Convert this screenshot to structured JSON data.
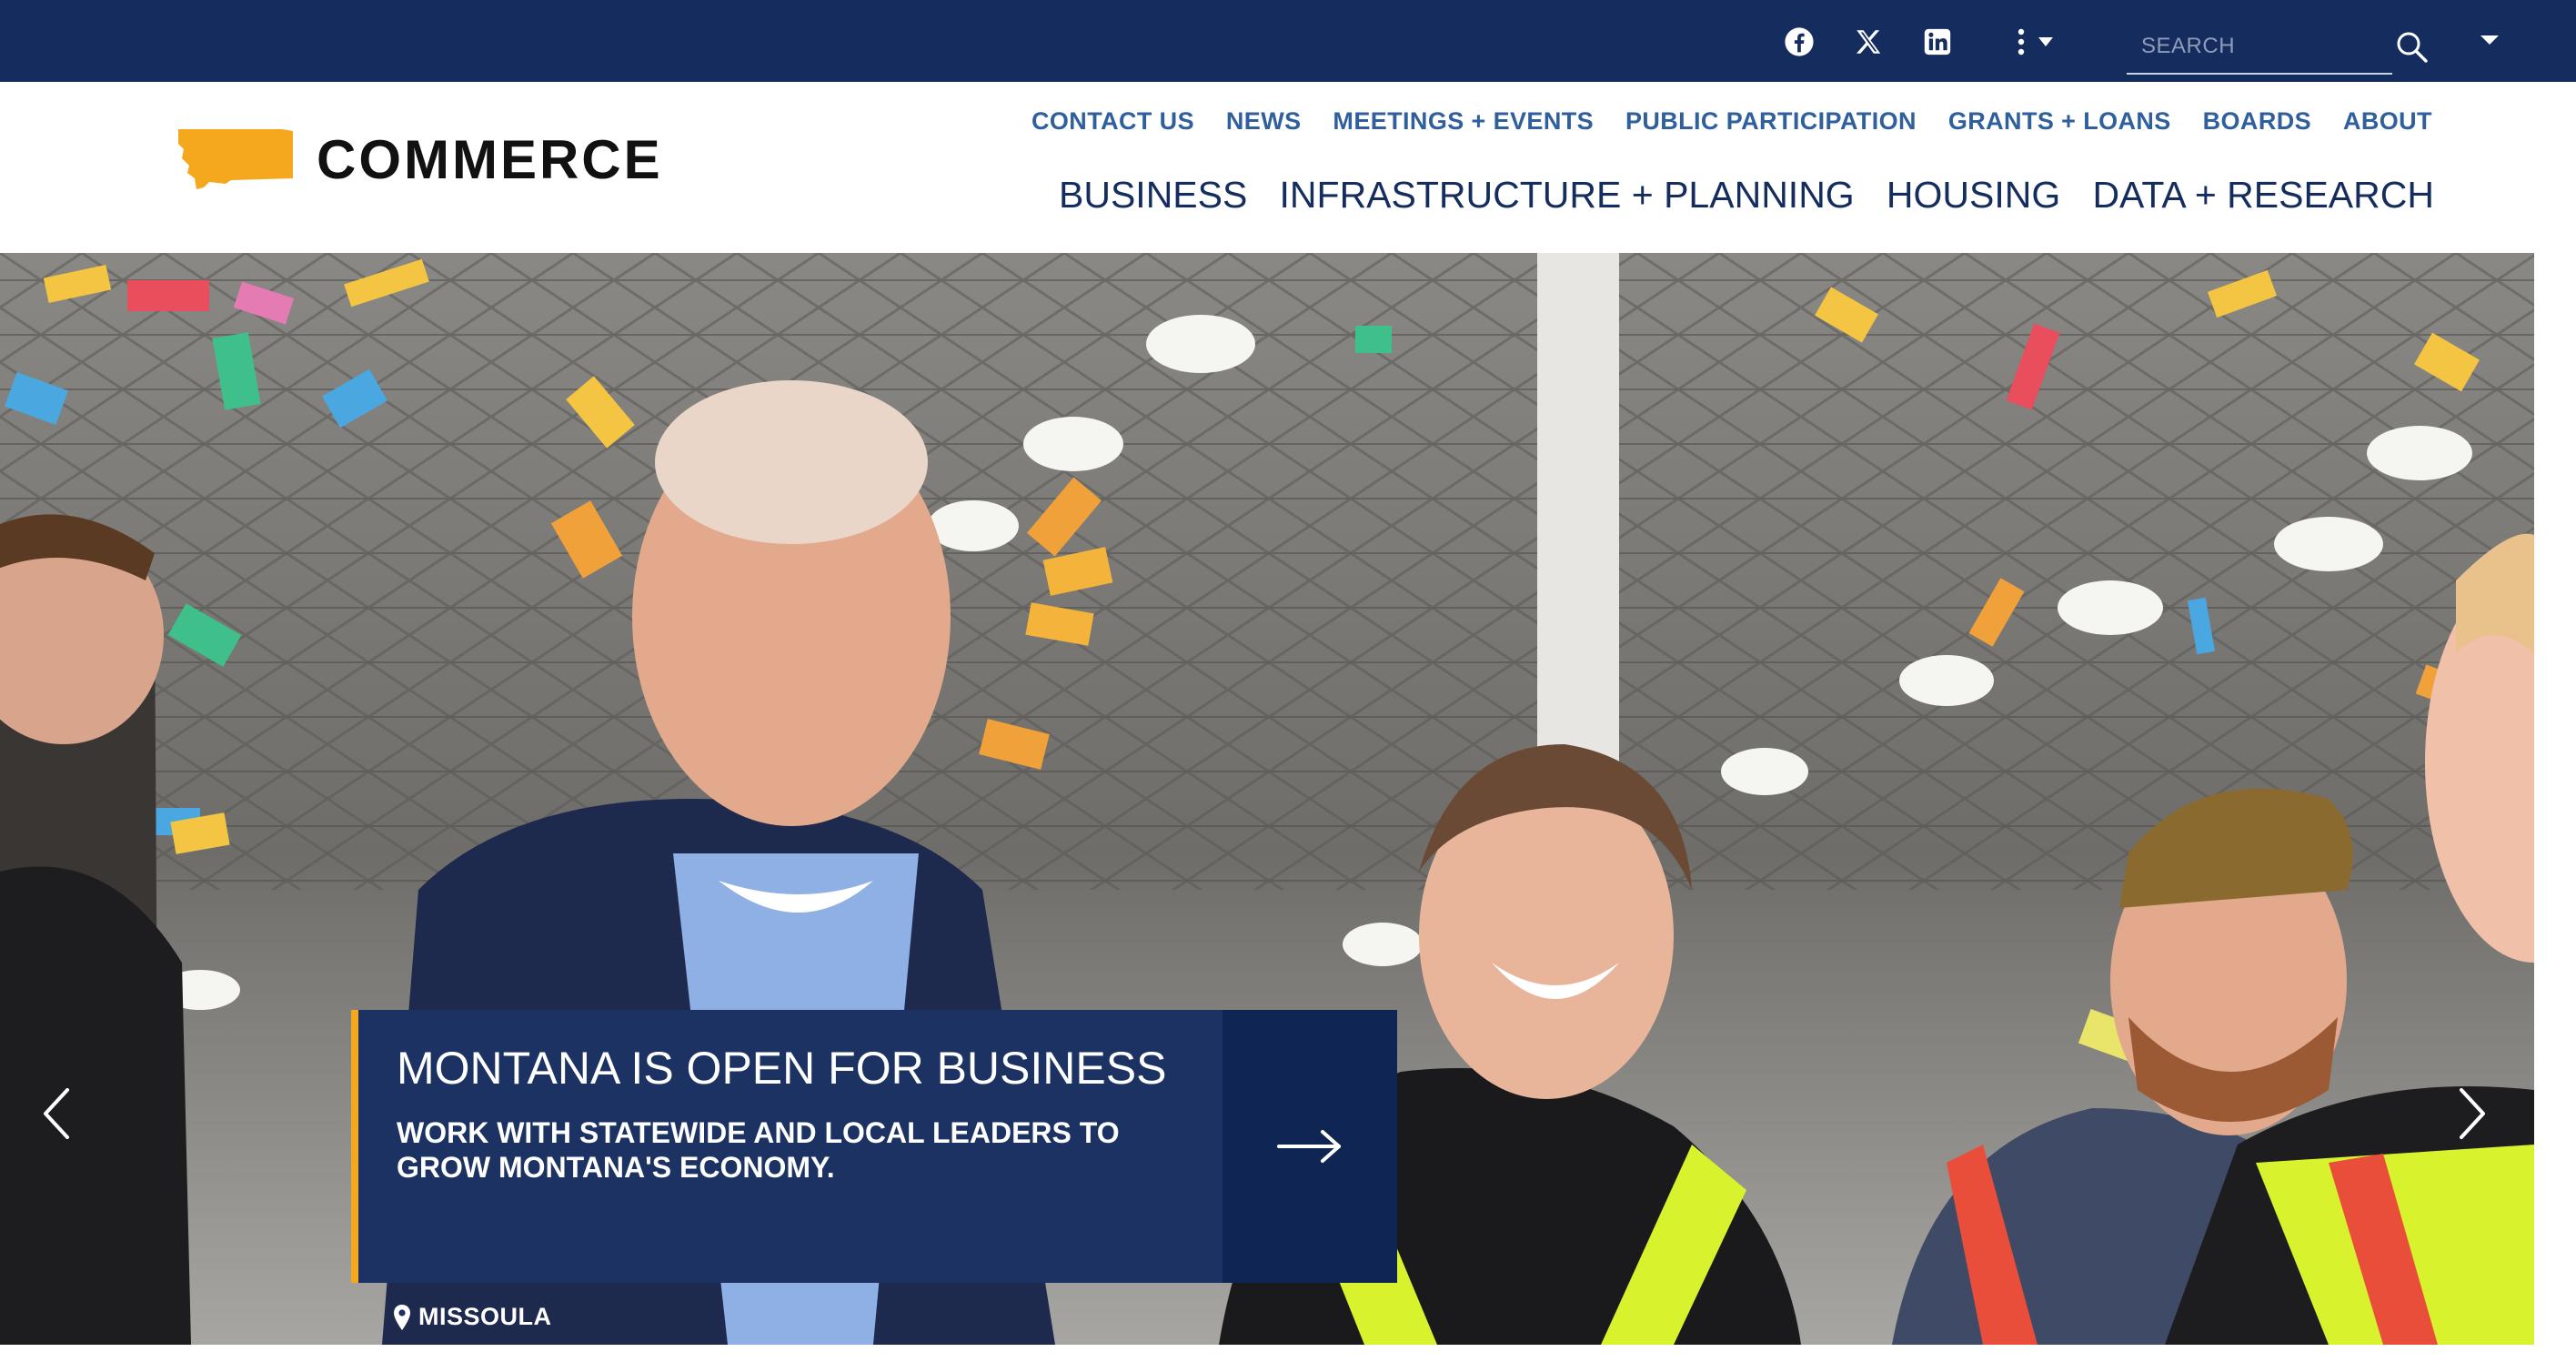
{
  "topbar": {
    "social": [
      "facebook-icon",
      "x-twitter-icon",
      "linkedin-icon"
    ],
    "search_placeholder": "SEARCH",
    "background_color": "#152d5e"
  },
  "header": {
    "logo_text": "COMMERCE",
    "logo_color": "#f4a81d",
    "utility_nav": [
      "CONTACT US",
      "NEWS",
      "MEETINGS + EVENTS",
      "PUBLIC PARTICIPATION",
      "GRANTS + LOANS",
      "BOARDS",
      "ABOUT"
    ],
    "main_nav": [
      "BUSINESS",
      "INFRASTRUCTURE + PLANNING",
      "HOUSING",
      "DATA + RESEARCH"
    ]
  },
  "hero": {
    "title": "MONTANA IS OPEN FOR BUSINESS",
    "subtitle": "WORK WITH STATEWIDE AND LOCAL LEADERS TO GROW MONTANA'S ECONOMY.",
    "location": "MISSOULA",
    "accent_color": "#f4a81d"
  }
}
